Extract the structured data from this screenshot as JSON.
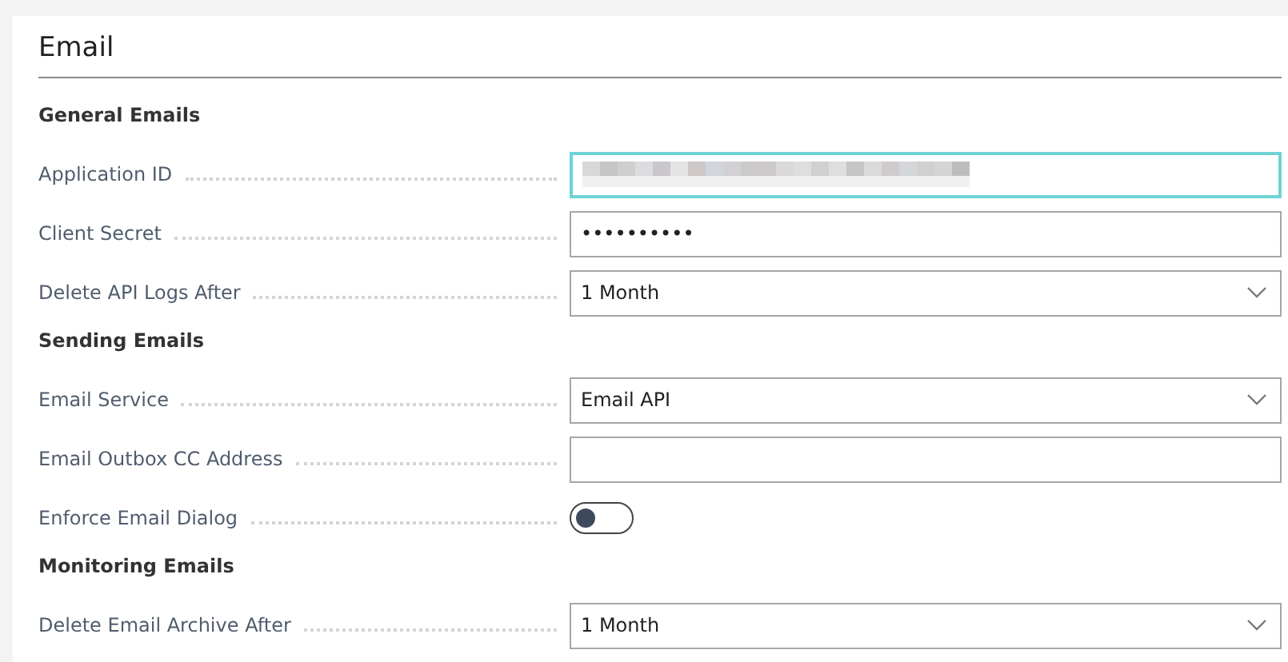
{
  "title": "Email",
  "sections": [
    {
      "heading": "General Emails",
      "fields": [
        {
          "label": "Application ID",
          "kind": "redacted",
          "focused": true
        },
        {
          "label": "Client Secret",
          "kind": "text",
          "value": "••••••••••",
          "focused": false
        },
        {
          "label": "Delete API Logs After",
          "kind": "select",
          "value": "1 Month",
          "focused": false
        }
      ]
    },
    {
      "heading": "Sending Emails",
      "fields": [
        {
          "label": "Email Service",
          "kind": "select",
          "value": "Email API",
          "focused": false
        },
        {
          "label": "Email Outbox CC Address",
          "kind": "text",
          "focused": false
        },
        {
          "label": "Enforce Email Dialog",
          "kind": "toggle",
          "on": false
        }
      ]
    },
    {
      "heading": "Monitoring Emails",
      "fields": [
        {
          "label": "Delete Email Archive After",
          "kind": "select",
          "value": "1 Month",
          "focused": false
        }
      ]
    }
  ]
}
